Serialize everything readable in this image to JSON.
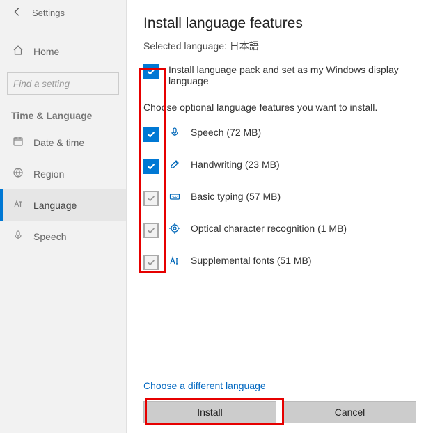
{
  "sidebar": {
    "title": "Settings",
    "home": "Home",
    "search_placeholder": "Find a setting",
    "section": "Time & Language",
    "items": [
      {
        "label": "Date & time"
      },
      {
        "label": "Region"
      },
      {
        "label": "Language"
      },
      {
        "label": "Speech"
      }
    ]
  },
  "main": {
    "title": "Install language features",
    "selected_prefix": "Selected language: ",
    "selected_lang": "日本語",
    "primary_option": "Install language pack and set as my Windows display language",
    "optional_text": "Choose optional language features you want to install.",
    "features": [
      {
        "label": "Speech (72 MB)",
        "checked": true
      },
      {
        "label": "Handwriting (23 MB)",
        "checked": true
      },
      {
        "label": "Basic typing (57 MB)",
        "checked": false
      },
      {
        "label": "Optical character recognition (1 MB)",
        "checked": false
      },
      {
        "label": "Supplemental fonts (51 MB)",
        "checked": false
      }
    ],
    "choose_diff": "Choose a different language",
    "install_btn": "Install",
    "cancel_btn": "Cancel"
  }
}
